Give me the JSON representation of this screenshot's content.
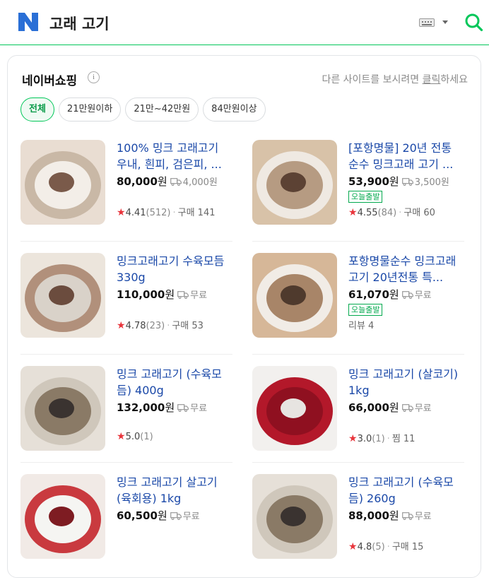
{
  "header": {
    "query": "고래 고기"
  },
  "section": {
    "title": "네이버쇼핑",
    "hint_prefix": "다른 사이트를 보시려면 ",
    "hint_link": "클릭",
    "hint_suffix": "하세요"
  },
  "chips": [
    "전체",
    "21만원이하",
    "21만~42만원",
    "84만원이상"
  ],
  "products": [
    {
      "title": "100% 밍크 고래고기 우내, 흰피, 검은피, ...",
      "price": "80,000",
      "won": "원",
      "ship": "4,000원",
      "badge": "",
      "rating": "4.41",
      "reviews": "(512)",
      "extra": "구매 141",
      "review_only": ""
    },
    {
      "title": "[포항명물] 20년 전통 순수 밍크고래 고기 ...",
      "price": "53,900",
      "won": "원",
      "ship": "3,500원",
      "badge": "오늘출발",
      "rating": "4.55",
      "reviews": "(84)",
      "extra": "구매 60",
      "review_only": ""
    },
    {
      "title": "밍크고래고기 수육모듬 330g",
      "price": "110,000",
      "won": "원",
      "ship": "무료",
      "badge": "",
      "rating": "4.78",
      "reviews": "(23)",
      "extra": "구매 53",
      "review_only": ""
    },
    {
      "title": "포항명물순수 밍크고래고기 20년전통 특...",
      "price": "61,070",
      "won": "원",
      "ship": "무료",
      "badge": "오늘출발",
      "rating": "",
      "reviews": "",
      "extra": "",
      "review_only": "리뷰 4"
    },
    {
      "title": "밍크 고래고기 (수육모듬) 400g",
      "price": "132,000",
      "won": "원",
      "ship": "무료",
      "badge": "",
      "rating": "5.0",
      "reviews": "(1)",
      "extra": "",
      "review_only": ""
    },
    {
      "title": "밍크 고래고기 (살코기) 1kg",
      "price": "66,000",
      "won": "원",
      "ship": "무료",
      "badge": "",
      "rating": "3.0",
      "reviews": "(1)",
      "extra": "찜 11",
      "review_only": ""
    },
    {
      "title": "밍크 고래고기 살고기 (육회용) 1kg",
      "price": "60,500",
      "won": "원",
      "ship": "무료",
      "badge": "",
      "rating": "",
      "reviews": "",
      "extra": "",
      "review_only": ""
    },
    {
      "title": "밍크 고래고기 (수육모듬) 260g",
      "price": "88,000",
      "won": "원",
      "ship": "무료",
      "badge": "",
      "rating": "4.8",
      "reviews": "(5)",
      "extra": "구매 15",
      "review_only": ""
    }
  ],
  "colors": {
    "accent": "#03c75a",
    "link": "#1a48a8",
    "star": "#e8343b",
    "logo": "#2a6fd6"
  },
  "icons": [
    "naver-logo-icon",
    "keyboard-icon",
    "chevron-down-icon",
    "search-icon",
    "info-icon",
    "truck-icon",
    "star-icon"
  ]
}
